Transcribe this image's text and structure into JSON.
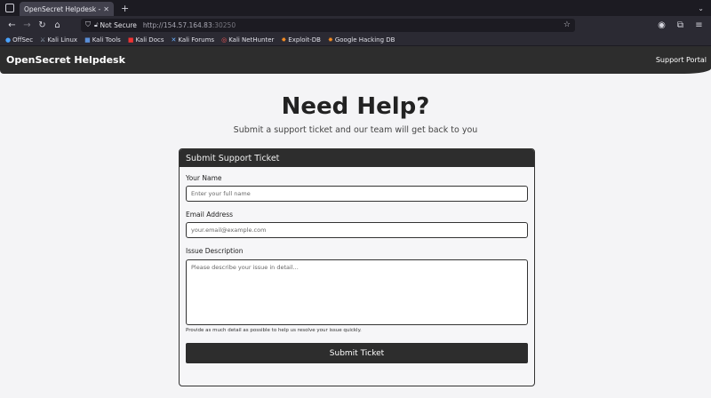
{
  "browser": {
    "tab_title": "OpenSecret Helpdesk - Supp",
    "security_label": "Not Secure",
    "url_scheme": "http://",
    "url_host": "154.57.164.83",
    "url_port": ":30250",
    "bookmarks": [
      "OffSec",
      "Kali Linux",
      "Kali Tools",
      "Kali Docs",
      "Kali Forums",
      "Kali NetHunter",
      "Exploit-DB",
      "Google Hacking DB"
    ]
  },
  "header": {
    "brand": "OpenSecret Helpdesk",
    "nav_link": "Support Portal"
  },
  "hero": {
    "title": "Need Help?",
    "subtitle": "Submit a support ticket and our team will get back to you"
  },
  "form": {
    "card_title": "Submit Support Ticket",
    "name_label": "Your Name",
    "name_placeholder": "Enter your full name",
    "email_label": "Email Address",
    "email_placeholder": "your.email@example.com",
    "issue_label": "Issue Description",
    "issue_placeholder": "Please describe your issue in detail...",
    "hint": "Provide as much detail as possible to help us resolve your issue quickly.",
    "submit_label": "Submit Ticket"
  },
  "colors": {
    "header_bg": "#2d2d2d",
    "page_bg": "#f4f4f6",
    "browser_bg": "#2b2a33"
  }
}
